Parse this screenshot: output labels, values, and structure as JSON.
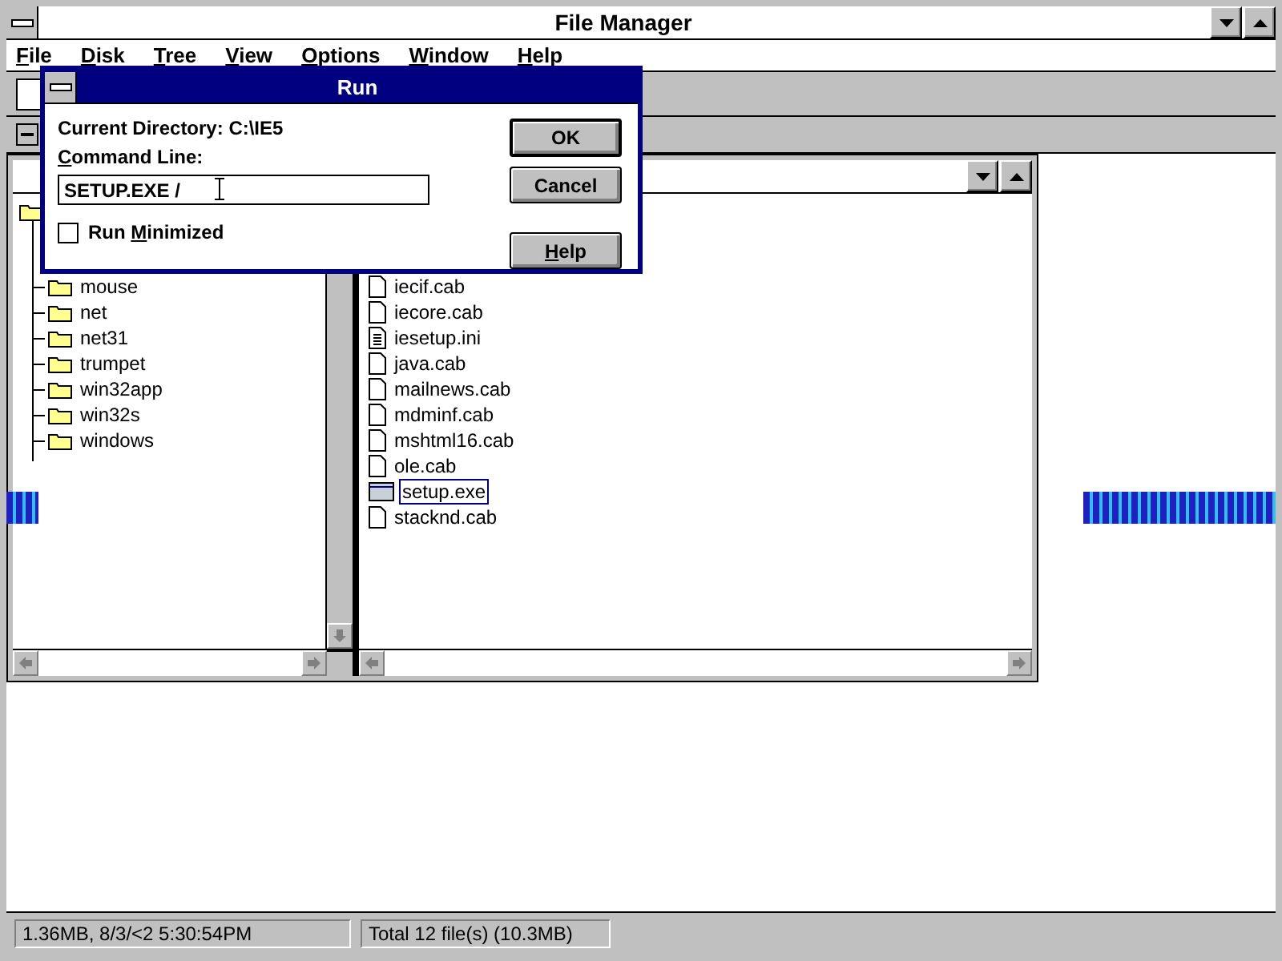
{
  "window": {
    "title": "File Manager"
  },
  "menu": [
    {
      "key": "F",
      "after": "ile"
    },
    {
      "key": "D",
      "after": "isk"
    },
    {
      "key": "T",
      "after": "ree"
    },
    {
      "key": "V",
      "after": "iew"
    },
    {
      "key": "O",
      "after": "ptions"
    },
    {
      "key": "W",
      "after": "indow"
    },
    {
      "key": "H",
      "after": "elp"
    }
  ],
  "tree": {
    "items": [
      {
        "name": "mouse"
      },
      {
        "name": "net"
      },
      {
        "name": "net31"
      },
      {
        "name": "trumpet"
      },
      {
        "name": "win32app"
      },
      {
        "name": "win32s"
      },
      {
        "name": "windows"
      }
    ]
  },
  "files": [
    {
      "name": "iecif.cab",
      "kind": "file",
      "selected": false
    },
    {
      "name": "iecore.cab",
      "kind": "file",
      "selected": false
    },
    {
      "name": "iesetup.ini",
      "kind": "text",
      "selected": false
    },
    {
      "name": "java.cab",
      "kind": "file",
      "selected": false
    },
    {
      "name": "mailnews.cab",
      "kind": "file",
      "selected": false
    },
    {
      "name": "mdminf.cab",
      "kind": "file",
      "selected": false
    },
    {
      "name": "mshtml16.cab",
      "kind": "file",
      "selected": false
    },
    {
      "name": "ole.cab",
      "kind": "file",
      "selected": false
    },
    {
      "name": "setup.exe",
      "kind": "program",
      "selected": true
    },
    {
      "name": "stacknd.cab",
      "kind": "file",
      "selected": false
    }
  ],
  "dialog": {
    "title": "Run",
    "current_directory": "Current Directory: C:\\IE5",
    "command_label": {
      "key": "C",
      "after": "ommand Line:"
    },
    "command_value": "SETUP.EXE /",
    "run_minimized": {
      "before": "Run ",
      "key": "M",
      "after": "inimized",
      "checked": false
    },
    "buttons": [
      {
        "after": "OK",
        "default": true
      },
      {
        "after": "Cancel",
        "default": false
      },
      {
        "key": "H",
        "after": "elp",
        "default": false
      }
    ]
  },
  "status_bar": [
    "1.36MB, 8/3/<2 5:30:54PM",
    "Total 12 file(s) (10.3MB)"
  ]
}
